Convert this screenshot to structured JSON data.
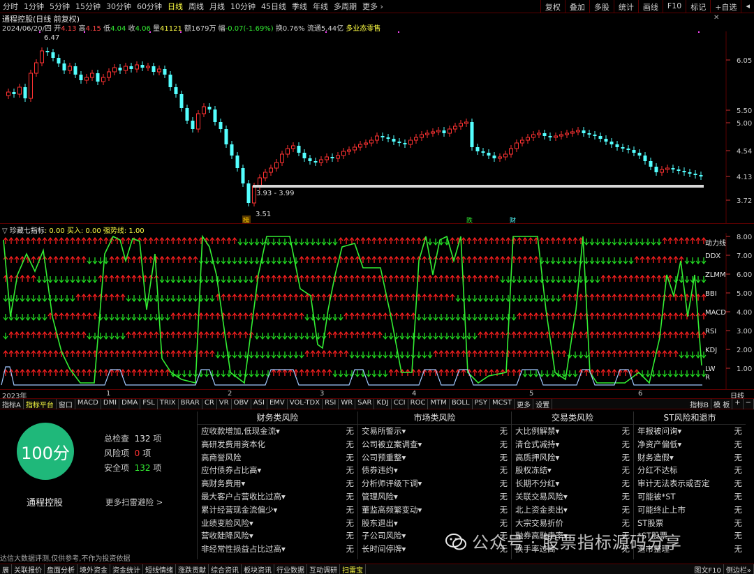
{
  "topbar": {
    "periods": [
      "分时",
      "1分钟",
      "5分钟",
      "15分钟",
      "30分钟",
      "60分钟",
      "日线",
      "周线",
      "月线",
      "10分钟",
      "45日线",
      "季线",
      "年线",
      "多周期",
      "更多 ›"
    ],
    "active_index": 6,
    "tools": [
      "复权",
      "叠加",
      "多股",
      "统计",
      "画线",
      "F10",
      "标记",
      "+自选",
      "◂"
    ]
  },
  "stock": {
    "title": "通程控股(日线 前复权)",
    "close_icon": "✕",
    "date": "2024/06/20/四",
    "open_label": "开",
    "open": "4.13",
    "high_label": "高",
    "high": "4.15",
    "low_label": "低",
    "low": "4.04",
    "close_label": "收",
    "close": "4.06",
    "volume_label": "量",
    "volume": "41121",
    "amount_label": "额",
    "amount": "1679万",
    "change_label": "幅",
    "change": "-0.07(-1.69%)",
    "turnover_label": "换",
    "turnover": "0.76%",
    "float_label": "流通",
    "float": "5.44亿",
    "tag": "多业态零售"
  },
  "price_axis": [
    "6.05",
    "5.50",
    "5.00",
    "4.54",
    "4.13",
    "3.72"
  ],
  "price_annotations": {
    "high_mark": "6.47",
    "low_mark": "3.51",
    "zone": "3.93 - 3.99"
  },
  "event_markers": [
    "榜",
    "跌",
    "财"
  ],
  "indicator": {
    "header_name": "珍藏七指标",
    "header_values": ": 0.00  买入: 0.00  强势线: 1.00",
    "axis": [
      "8.00",
      "7.00",
      "6.00",
      "5.00",
      "4.00",
      "3.00",
      "2.00",
      "1.00"
    ],
    "row_labels": [
      "动力线",
      "DDX",
      "ZLMM",
      "BBI",
      "MACD",
      "RSI",
      "KDJ",
      "LW",
      "R"
    ]
  },
  "time_axis": {
    "year": "2023年",
    "months": [
      "1",
      "2",
      "3",
      "4",
      "5",
      "6"
    ],
    "period_label": "日线"
  },
  "bottom_tabs": [
    "指标A",
    "指标平台",
    "窗口",
    "MACD",
    "DMI",
    "DMA",
    "FSL",
    "TRIX",
    "BRAR",
    "CR",
    "VR",
    "OBV",
    "ASI",
    "EMV",
    "VOL-TDX",
    "RSI",
    "WR",
    "SAR",
    "KDJ",
    "CCI",
    "ROC",
    "MTM",
    "BOLL",
    "PSY",
    "MCST",
    "更多",
    "设置"
  ],
  "bottom_tabs_right": [
    "指标B",
    "模 板",
    "+",
    "−"
  ],
  "risk": {
    "score": "100分",
    "stock_name": "通程控股",
    "checked_label": "总检查",
    "checked_count": "132",
    "checked_unit": "项",
    "risk_label": "风险项",
    "risk_count": "0",
    "risk_unit": "项",
    "safe_label": "安全项",
    "safe_count": "132",
    "safe_unit": "项",
    "more_link": "更多扫雷避险 >",
    "disclaimer": "达信大数据评测,仅供参考,不作为投资依据",
    "columns": [
      {
        "title": "财务类风险",
        "items": [
          [
            "应收款增加,低现金流▾",
            "无"
          ],
          [
            "高研发费用资本化",
            "无"
          ],
          [
            "高商誉风险",
            "无"
          ],
          [
            "应付债券占比高▾",
            "无"
          ],
          [
            "高财务费用▾",
            "无"
          ],
          [
            "最大客户占营收比过高▾",
            "无"
          ],
          [
            "累计经营现金流偏少▾",
            "无"
          ],
          [
            "业绩变脸风险▾",
            "无"
          ],
          [
            "营收陡降风险▾",
            "无"
          ],
          [
            "非经常性损益占比过高▾",
            "无"
          ]
        ]
      },
      {
        "title": "市场类风险",
        "items": [
          [
            "交易所警示▾",
            "无"
          ],
          [
            "公司被立案调查▾",
            "无"
          ],
          [
            "公司预重整▾",
            "无"
          ],
          [
            "债券违约▾",
            "无"
          ],
          [
            "分析师评级下调▾",
            "无"
          ],
          [
            "管理风险▾",
            "无"
          ],
          [
            "董监高频繁变动▾",
            "无"
          ],
          [
            "股东退出▾",
            "无"
          ],
          [
            "子公司风险▾",
            "无"
          ],
          [
            "长时间停牌▾",
            "无"
          ]
        ]
      },
      {
        "title": "交易类风险",
        "items": [
          [
            "大比例解禁▾",
            "无"
          ],
          [
            "清仓式减持▾",
            "无"
          ],
          [
            "高质押风险▾",
            "无"
          ],
          [
            "股权冻结▾",
            "无"
          ],
          [
            "长期不分红▾",
            "无"
          ],
          [
            "关联交易风险▾",
            "无"
          ],
          [
            "北上资金卖出▾",
            "无"
          ],
          [
            "大宗交易折价",
            "无"
          ],
          [
            "融券高融卖率▾",
            "无"
          ],
          [
            "换手率过高",
            "无"
          ]
        ]
      },
      {
        "title": "ST风险和退市",
        "items": [
          [
            "年报被问询▾",
            "无"
          ],
          [
            "净资产偏低▾",
            "无"
          ],
          [
            "财务造假▾",
            "无"
          ],
          [
            "分红不达标",
            "无"
          ],
          [
            "审计无法表示或否定",
            "无"
          ],
          [
            "可能被*ST",
            "无"
          ],
          [
            "可能终止上市",
            "无"
          ],
          [
            "ST股票",
            "无"
          ],
          [
            "*ST股票",
            "无"
          ],
          [
            "退市整理",
            "无"
          ]
        ]
      }
    ]
  },
  "watermark": "公众号 · 股票指标源码分享",
  "footer_tabs": [
    "展",
    "关联报价",
    "盘面分析",
    "境外资金",
    "资金统计",
    "短线情绪",
    "涨跌贡献",
    "综合资讯",
    "板块资讯",
    "行业数据",
    "互动调研",
    "扫雷宝"
  ],
  "footer_right": [
    "图文F10",
    "侧边栏»"
  ],
  "colors": {
    "up": "#ff3232",
    "down": "#54ffff",
    "green": "#33ee33",
    "grid": "#5a0000",
    "highlight": "#ffff44"
  }
}
